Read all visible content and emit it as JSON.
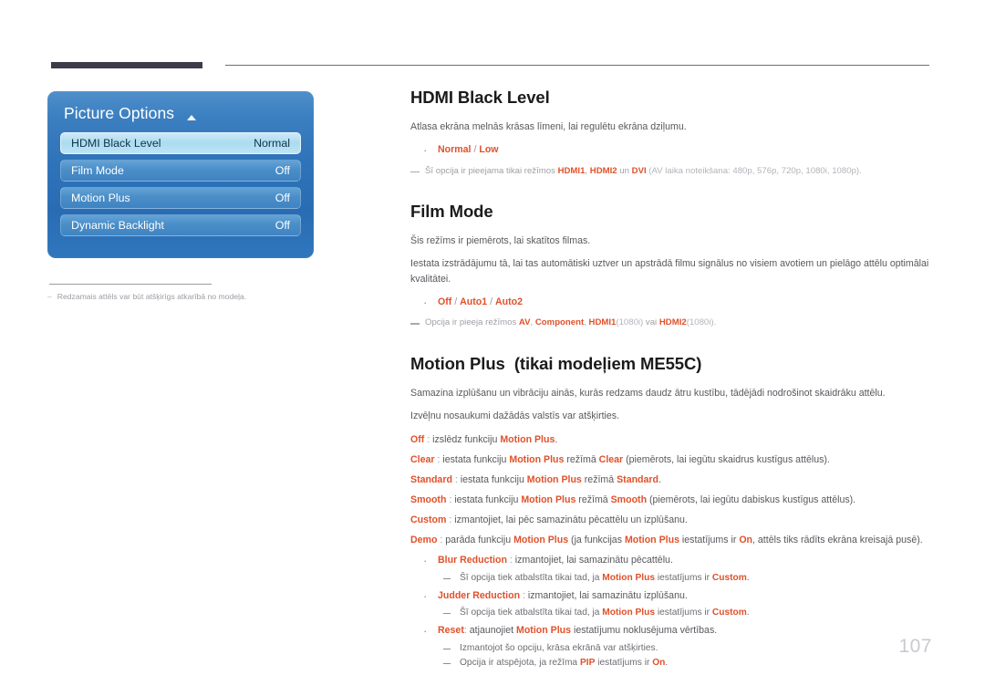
{
  "page": {
    "number": "107"
  },
  "osd": {
    "title": "Picture Options",
    "caret_icon": "caret-up-icon",
    "rows": [
      {
        "label": "HDMI Black Level",
        "value": "Normal",
        "selected": true
      },
      {
        "label": "Film Mode",
        "value": "Off",
        "selected": false
      },
      {
        "label": "Motion Plus",
        "value": "Off",
        "selected": false
      },
      {
        "label": "Dynamic Backlight",
        "value": "Off",
        "selected": false
      }
    ],
    "footnote": {
      "dash": "–",
      "text": "Redzamais attēls var būt atšķirīgs atkarībā no modeļa."
    }
  },
  "sections": {
    "hdmi_black_level": {
      "heading": "HDMI Black Level",
      "intro": "Atlasa ekrāna melnās krāsas līmeni, lai regulētu ekrāna dziļumu.",
      "options": {
        "a": "Normal",
        "slash": " / ",
        "b": "Low"
      },
      "note": {
        "pre": "Šī opcija ir pieejama tikai režīmos ",
        "k1": "HDMI1",
        "mid1": ", ",
        "k2": "HDMI2",
        "mid2": " un ",
        "k3": "DVI",
        "post": " (AV laika noteikšana: 480p, 576p, 720p, 1080i, 1080p)."
      }
    },
    "film_mode": {
      "heading": "Film Mode",
      "p1": "Šis režīms ir piemērots, lai skatītos filmas.",
      "p2": "Iestata izstrādājumu tā, lai tas automātiski uztver un apstrādā filmu signālus no visiem avotiem un pielāgo attēlu optimālai kvalitātei.",
      "options": {
        "a": "Off",
        "s1": " / ",
        "b": "Auto1",
        "s2": " / ",
        "c": "Auto2"
      },
      "note": {
        "pre": "Opcija ir pieeja režīmos ",
        "k1": "AV",
        "mid1": ", ",
        "k2": "Component",
        "mid2": ", ",
        "k3": "HDMI1",
        "dim1": "(1080i)",
        "mid3": " vai ",
        "k4": "HDMI2",
        "dim2": "(1080i)",
        "post": "."
      }
    },
    "motion_plus": {
      "heading_main": "Motion Plus",
      "heading_sub": "(tikai modeļiem ME55C)",
      "p1": "Samazina izplūšanu un vibrāciju ainās, kurās redzams daudz ātru kustību, tādējādi nodrošinot skaidrāku attēlu.",
      "p2": "Izvēļnu nosaukumi dažādās valstīs var atšķirties.",
      "definitions": [
        {
          "term": "Off",
          "sep": " : ",
          "pre": "izslēdz funkciju ",
          "k1": "Motion Plus",
          "post": "."
        },
        {
          "term": "Clear",
          "sep": " : ",
          "pre": "iestata funkciju ",
          "k1": "Motion Plus",
          "mid": " režīmā ",
          "k2": "Clear",
          "post": " (piemērots, lai iegūtu skaidrus kustīgus attēlus)."
        },
        {
          "term": "Standard",
          "sep": " : ",
          "pre": "iestata funkciju ",
          "k1": "Motion Plus",
          "mid": " režīmā ",
          "k2": "Standard",
          "post": "."
        },
        {
          "term": "Smooth",
          "sep": " : ",
          "pre": "iestata funkciju ",
          "k1": "Motion Plus",
          "mid": " režīmā ",
          "k2": "Smooth",
          "post": " (piemērots, lai iegūtu dabiskus kustīgus attēlus)."
        },
        {
          "term": "Custom",
          "sep": " : ",
          "pre": "izmantojiet, lai pēc samazinātu pēcattēlu un izplūšanu.",
          "k1": "",
          "post": ""
        },
        {
          "term": "Demo",
          "sep": " : ",
          "pre": "parāda funkciju ",
          "k1": "Motion Plus",
          "mid": " (ja funkcijas ",
          "k2": "Motion Plus",
          "mid2": " iestatījums ir ",
          "k3": "On",
          "post": ", attēls tiks rādīts ekrāna kreisajā pusē)."
        }
      ],
      "bullets": [
        {
          "term": "Blur Reduction",
          "sep": " : ",
          "text": "izmantojiet, lai samazinātu pēcattēlu.",
          "subs": [
            {
              "pre": "Šī opcija tiek atbalstīta tikai tad, ja ",
              "k1": "Motion Plus",
              "mid": " iestatījums ir ",
              "k2": "Custom",
              "post": "."
            }
          ]
        },
        {
          "term": "Judder Reduction",
          "sep": " : ",
          "text": "izmantojiet, lai samazinātu izplūšanu.",
          "subs": [
            {
              "pre": "Šī opcija tiek atbalstīta tikai tad, ja ",
              "k1": "Motion Plus",
              "mid": " iestatījums ir ",
              "k2": "Custom",
              "post": "."
            }
          ]
        },
        {
          "term": "Reset",
          "sep": ": ",
          "pre": "atjaunojiet ",
          "k1": "Motion Plus",
          "text": " iestatījumu noklusējuma vērtības.",
          "subs": [
            {
              "pre": "Izmantojot šo opciju, krāsa ekrānā var atšķirties.",
              "k1": "",
              "mid": "",
              "k2": "",
              "post": ""
            },
            {
              "pre": "Opcija ir atspējota, ja režīma ",
              "k1": "PIP",
              "mid": " iestatījums ir ",
              "k2": "On",
              "post": "."
            }
          ]
        }
      ]
    }
  },
  "colors": {
    "accent": "#e0512a",
    "header_bar": "#3e3a4a",
    "osd_blue": "#2f73b9",
    "page_number": "#c9c9d2"
  }
}
